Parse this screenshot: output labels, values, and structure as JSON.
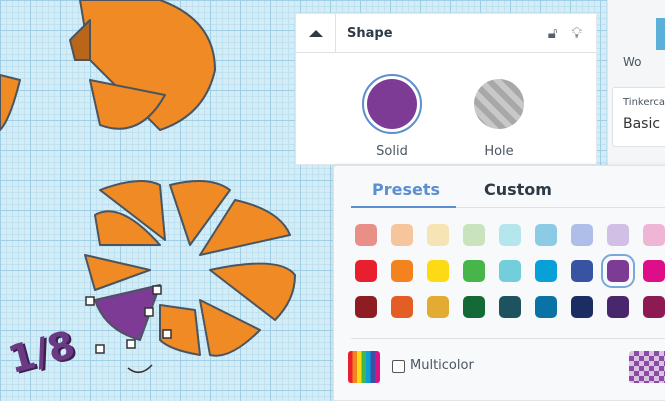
{
  "canvas": {
    "label_text": "1/8"
  },
  "shape_panel": {
    "title": "Shape",
    "solid_label": "Solid",
    "hole_label": "Hole",
    "solid_color": "#7d3b96"
  },
  "sidebar": {
    "workplane_label": "Wo",
    "library_title": "Tinkerca",
    "library_value": "Basic"
  },
  "color_popup": {
    "tabs": [
      {
        "label": "Presets",
        "active": true
      },
      {
        "label": "Custom",
        "active": false
      }
    ],
    "swatches": [
      [
        "#e89088",
        "#f7c59c",
        "#f7e4b5",
        "#c8e3bd",
        "#b5e6ed",
        "#8ccbe6",
        "#afbde9",
        "#d2bfe6",
        "#efb5d4"
      ],
      [
        "#e81f2f",
        "#f4821f",
        "#fddb14",
        "#47b54a",
        "#72cedb",
        "#07a0d8",
        "#3953a3",
        "#7d3b96",
        "#de0e88"
      ],
      [
        "#8e1c23",
        "#e35d24",
        "#e4ab33",
        "#146a36",
        "#1c535f",
        "#0a72a4",
        "#1a2e64",
        "#49276c",
        "#8d1a52"
      ]
    ],
    "selected": "#7d3b96",
    "multicolor_label": "Multicolor",
    "multicolor_checked": false
  }
}
